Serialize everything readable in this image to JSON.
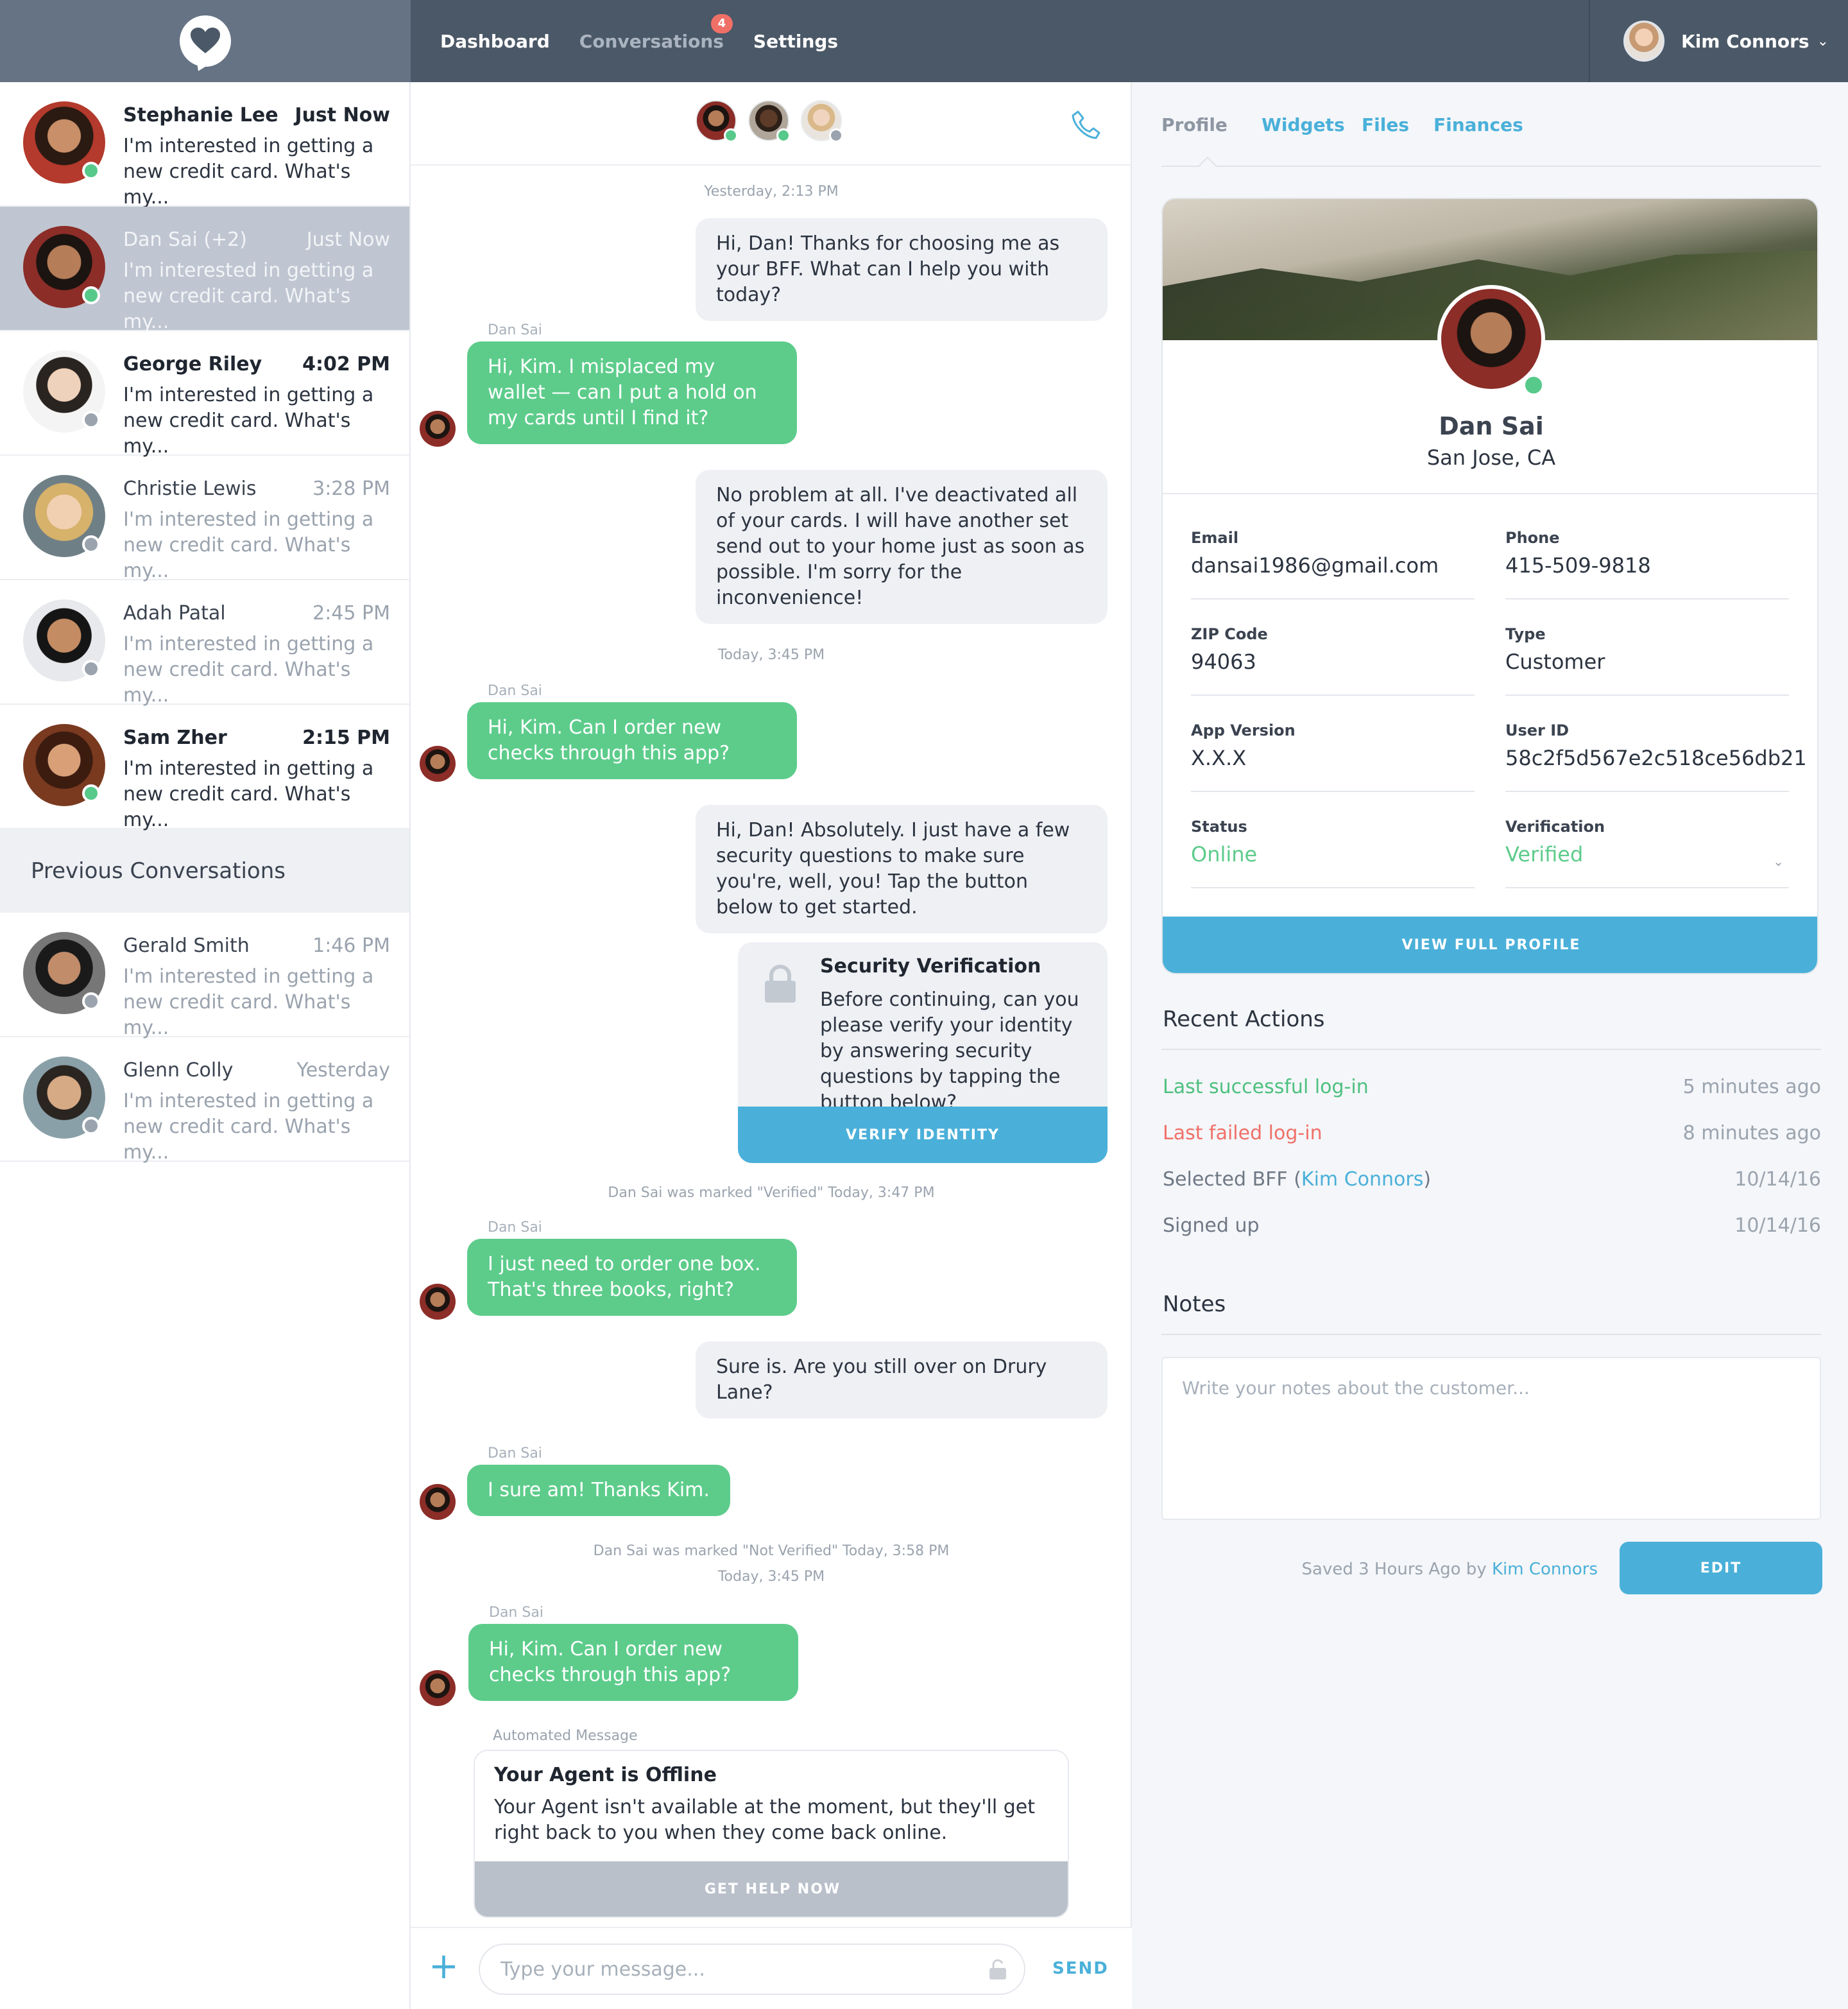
{
  "nav": {
    "items": [
      {
        "label": "Dashboard"
      },
      {
        "label": "Conversations",
        "badge": "4"
      },
      {
        "label": "Settings"
      }
    ],
    "user_name": "Kim Connors"
  },
  "conversations": [
    {
      "name": "Stephanie Lee",
      "time": "Just Now",
      "preview": "I'm interested in getting a new credit card. What's my..."
    },
    {
      "name": "Dan Sai (+2)",
      "time": "Just Now",
      "preview": "I'm interested in getting a new credit card. What's my..."
    },
    {
      "name": "George Riley",
      "time": "4:02 PM",
      "preview": "I'm interested in getting a new credit card. What's my..."
    },
    {
      "name": "Christie Lewis",
      "time": "3:28 PM",
      "preview": "I'm interested in getting a new credit card. What's my..."
    },
    {
      "name": "Adah Patal",
      "time": "2:45 PM",
      "preview": "I'm interested in getting a new credit card. What's my..."
    },
    {
      "name": "Sam Zher",
      "time": "2:15 PM",
      "preview": "I'm interested in getting a new credit card. What's my..."
    }
  ],
  "previous_heading": "Previous Conversations",
  "previous": [
    {
      "name": "Gerald Smith",
      "time": "1:46 PM",
      "preview": "I'm interested in getting a new credit card. What's my..."
    },
    {
      "name": "Glenn Colly",
      "time": "Yesterday",
      "preview": "I'm interested in getting a new credit card. What's my..."
    }
  ],
  "chat": {
    "ts1": "Yesterday, 2:13 PM",
    "m1": "Hi, Dan! Thanks for choosing me as your BFF. What can I help you with today?",
    "who": "Dan Sai",
    "m2": "Hi, Kim. I misplaced my wallet — can I put a hold on my cards until I find it?",
    "m3": "No problem at all. I've deactivated all of your cards. I will have another set send out to your home just as soon as possible. I'm sorry for the inconvenience!",
    "ts2": "Today, 3:45 PM",
    "m4": "Hi, Kim. Can I order new checks through this app?",
    "m5": "Hi, Dan! Absolutely. I just have a few security questions to make sure you're, well, you! Tap the button below to get started.",
    "verify_title": "Security Verification",
    "verify_body": "Before continuing, can you please verify your identity by answering security questions by tapping the button below?",
    "verify_button": "VERIFY IDENTITY",
    "sys1": "Dan Sai was marked \"Verified\" Today, 3:47 PM",
    "m6": "I just need to order one box. That's three books, right?",
    "m7": "Sure is. Are you still over on Drury Lane?",
    "m8": "I sure am! Thanks Kim.",
    "sys2": "Dan Sai was marked \"Not Verified\" Today, 3:58 PM",
    "ts3": "Today, 3:45 PM",
    "m9": "Hi, Kim. Can I order new checks through this app?",
    "auto_label": "Automated Message",
    "auto_title": "Your Agent is Offline",
    "auto_body": "Your Agent isn't available at the moment, but they'll get right back to you when they come back online.",
    "auto_button": "GET HELP NOW",
    "input_placeholder": "Type your message...",
    "send_label": "SEND"
  },
  "profile": {
    "tabs": [
      "Profile",
      "Widgets",
      "Files",
      "Finances"
    ],
    "name": "Dan Sai",
    "location": "San Jose, CA",
    "fields": {
      "email_label": "Email",
      "email": "dansai1986@gmail.com",
      "phone_label": "Phone",
      "phone": "415-509-9818",
      "zip_label": "ZIP Code",
      "zip": "94063",
      "type_label": "Type",
      "type": "Customer",
      "app_label": "App Version",
      "app": "X.X.X",
      "uid_label": "User ID",
      "uid": "58c2f5d567e2c518ce56db21",
      "status_label": "Status",
      "status": "Online",
      "verif_label": "Verification",
      "verif": "Verified"
    },
    "view_button": "VIEW FULL PROFILE"
  },
  "recent": {
    "title": "Recent Actions",
    "a1_label": "Last successful log-in",
    "a1_time": "5 minutes ago",
    "a2_label": "Last failed log-in",
    "a2_time": "8 minutes ago",
    "a3_prefix": "Selected BFF (",
    "a3_link": "Kim Connors",
    "a3_suffix": ")",
    "a3_time": "10/14/16",
    "a4_label": "Signed up",
    "a4_time": "10/14/16"
  },
  "notes": {
    "title": "Notes",
    "placeholder": "Write your notes about the customer...",
    "saved_prefix": "Saved 3 Hours Ago by ",
    "saved_by": "Kim Connors",
    "edit_button": "EDIT"
  },
  "colors": {
    "accent": "#4ab0d9",
    "green": "#5dcc8b",
    "red": "#f07068",
    "topbar": "#4b5867"
  }
}
